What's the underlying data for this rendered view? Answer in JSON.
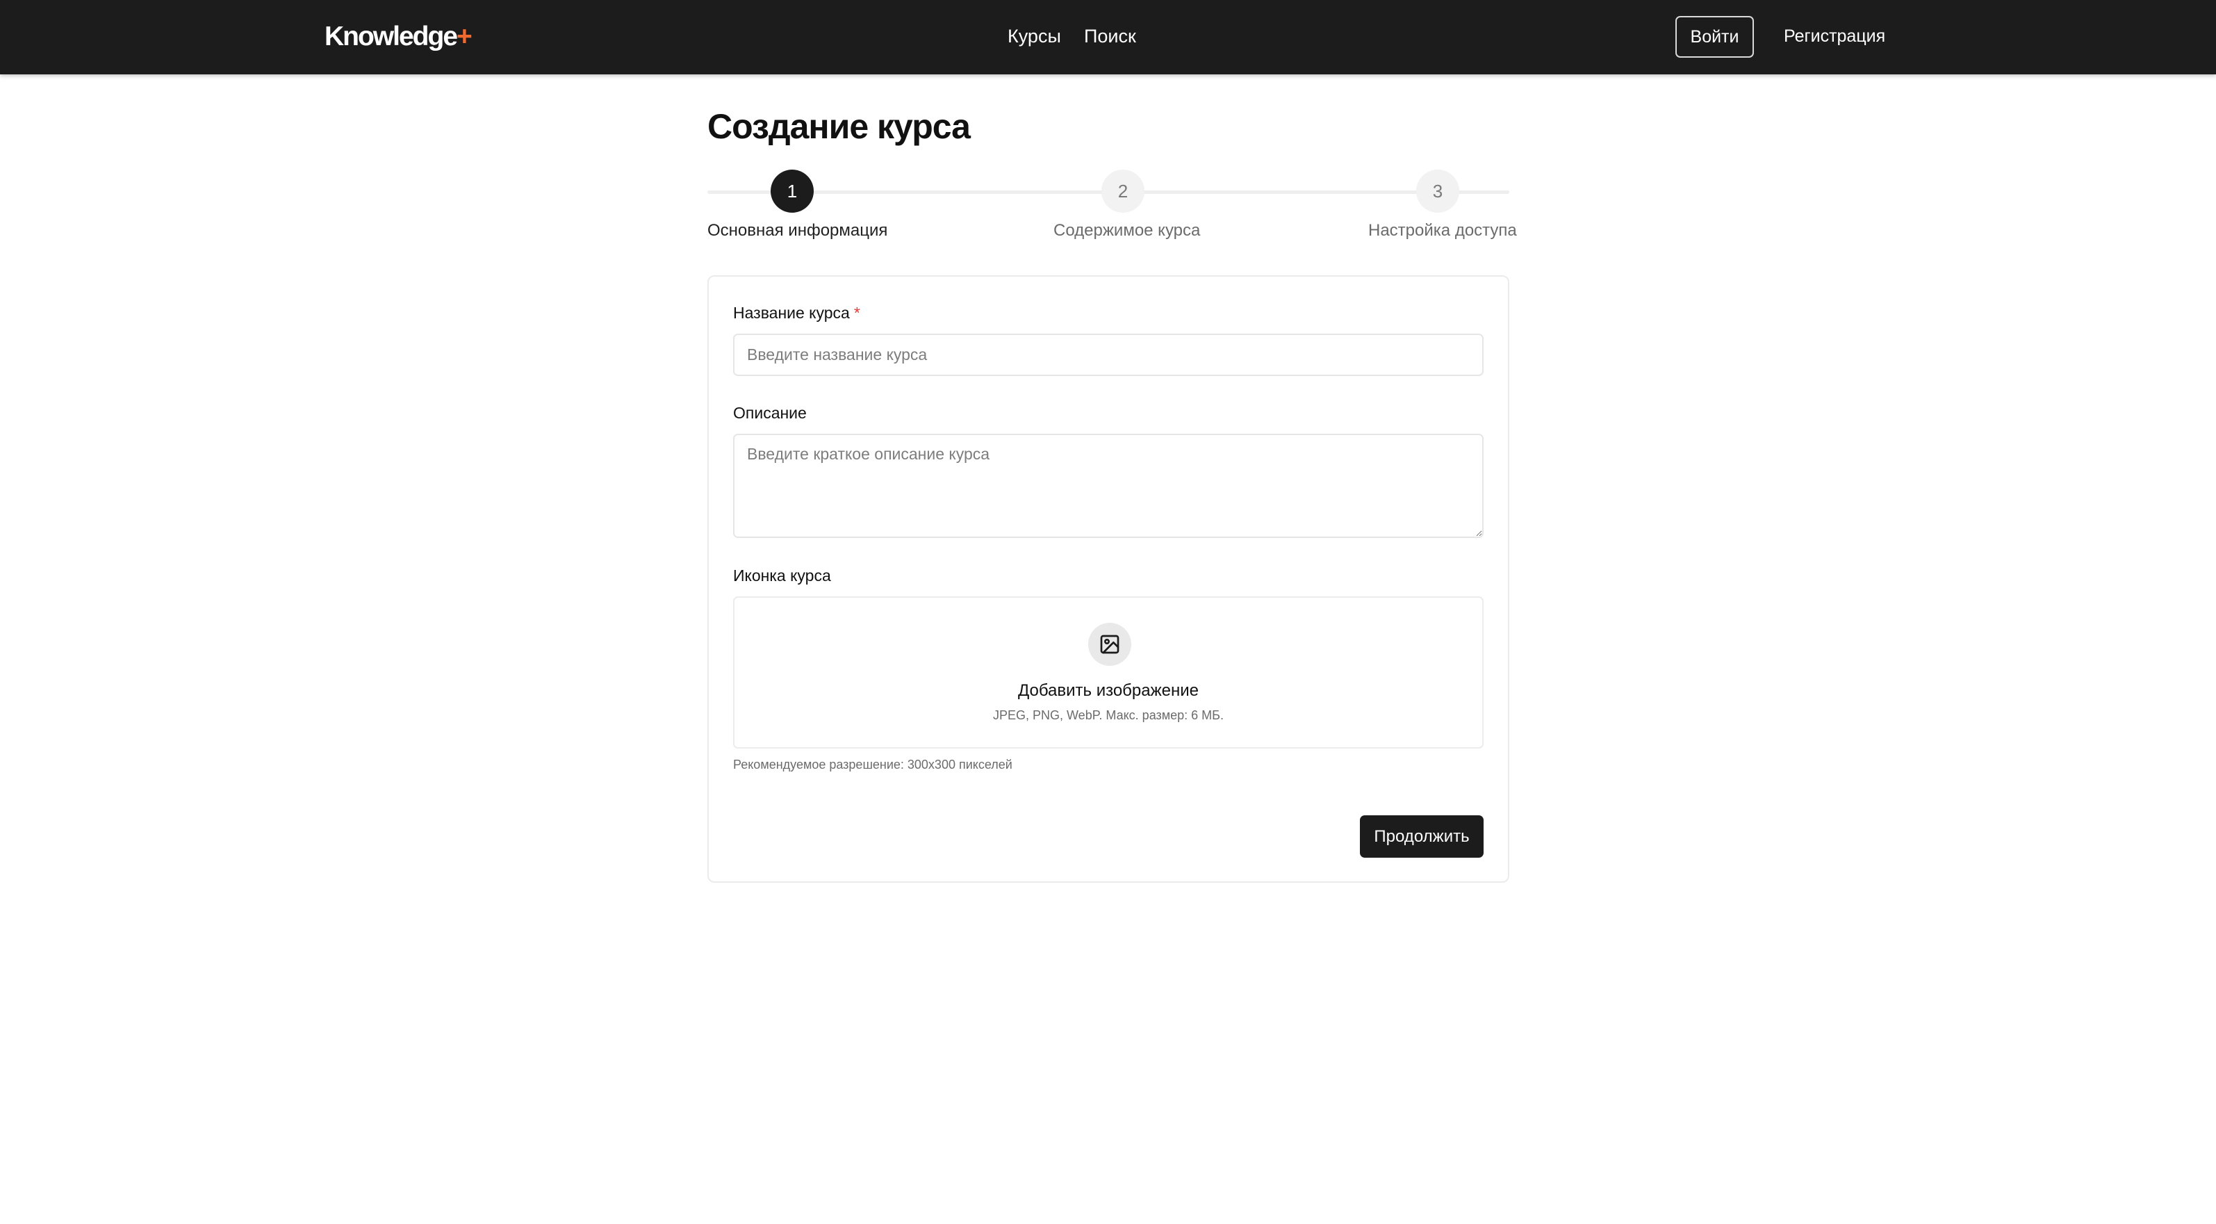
{
  "header": {
    "logo_text": "Knowledge",
    "logo_plus": "+",
    "nav": [
      "Курсы",
      "Поиск"
    ],
    "login_label": "Войти",
    "register_label": "Регистрация",
    "colors": {
      "background": "#1c1c1c",
      "accent": "#f26a2e"
    }
  },
  "page": {
    "title": "Создание курса"
  },
  "stepper": {
    "active_step": 1,
    "steps": [
      {
        "number": "1",
        "label": "Основная информация"
      },
      {
        "number": "2",
        "label": "Содержимое курса"
      },
      {
        "number": "3",
        "label": "Настройка доступа"
      }
    ]
  },
  "form": {
    "name": {
      "label": "Название курса",
      "required_mark": "*",
      "value": "",
      "placeholder": "Введите название курса"
    },
    "description": {
      "label": "Описание",
      "value": "",
      "placeholder": "Введите краткое описание курса"
    },
    "icon": {
      "label": "Иконка курса",
      "icon": "image-icon",
      "upload_title": "Добавить изображение",
      "upload_hint": "JPEG, PNG, WebP. Макс. размер: 6 МБ.",
      "recommendation": "Рекомендуемое разрешение: 300x300 пикселей"
    },
    "continue_label": "Продолжить"
  }
}
